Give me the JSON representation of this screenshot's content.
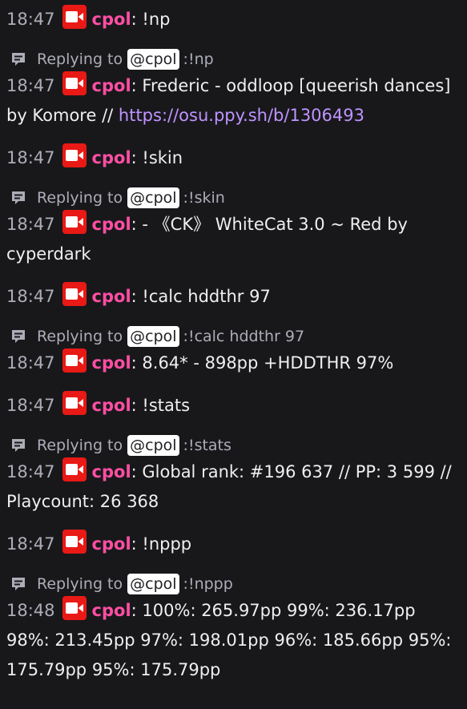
{
  "chat": {
    "messages": [
      {
        "reply": null,
        "time": "18:47",
        "user": "cpol",
        "text": "!np"
      },
      {
        "reply": {
          "label": "Replying to",
          "mention": "@cpol",
          "text": ":!np"
        },
        "time": "18:47",
        "user": "cpol",
        "text": "Frederic - oddloop [queerish dances] by Komore // ",
        "link": "https://osu.ppy.sh/b/1306493"
      },
      {
        "reply": null,
        "time": "18:47",
        "user": "cpol",
        "text": "!skin"
      },
      {
        "reply": {
          "label": "Replying to",
          "mention": "@cpol",
          "text": ":!skin"
        },
        "time": "18:47",
        "user": "cpol",
        "text": "- 《CK》 WhiteCat 3.0 ~ Red by cyperdark"
      },
      {
        "reply": null,
        "time": "18:47",
        "user": "cpol",
        "text": "!calc hddthr 97"
      },
      {
        "reply": {
          "label": "Replying to",
          "mention": "@cpol",
          "text": ":!calc hddthr 97"
        },
        "time": "18:47",
        "user": "cpol",
        "text": "8.64* - 898pp +HDDTHR 97%"
      },
      {
        "reply": null,
        "time": "18:47",
        "user": "cpol",
        "text": "!stats"
      },
      {
        "reply": {
          "label": "Replying to",
          "mention": "@cpol",
          "text": ":!stats"
        },
        "time": "18:47",
        "user": "cpol",
        "text": "Global rank: #196 637 // PP: 3 599 // Playcount: 26 368"
      },
      {
        "reply": null,
        "time": "18:47",
        "user": "cpol",
        "text": "!nppp"
      },
      {
        "reply": {
          "label": "Replying to",
          "mention": "@cpol",
          "text": ":!nppp"
        },
        "time": "18:48",
        "user": "cpol",
        "text": "100%: 265.97pp 99%: 236.17pp 98%: 213.45pp 97%: 198.01pp 96%: 185.66pp 95%: 175.79pp 95%: 175.79pp"
      }
    ],
    "colon": ":",
    "badge_icon": "broadcaster-camera-icon",
    "reply_icon": "reply-chat-icon"
  },
  "colors": {
    "background": "#18181b",
    "username": "#ff4fa3",
    "badge": "#e91916",
    "link": "#bf94ff",
    "muted": "#adadb8"
  }
}
